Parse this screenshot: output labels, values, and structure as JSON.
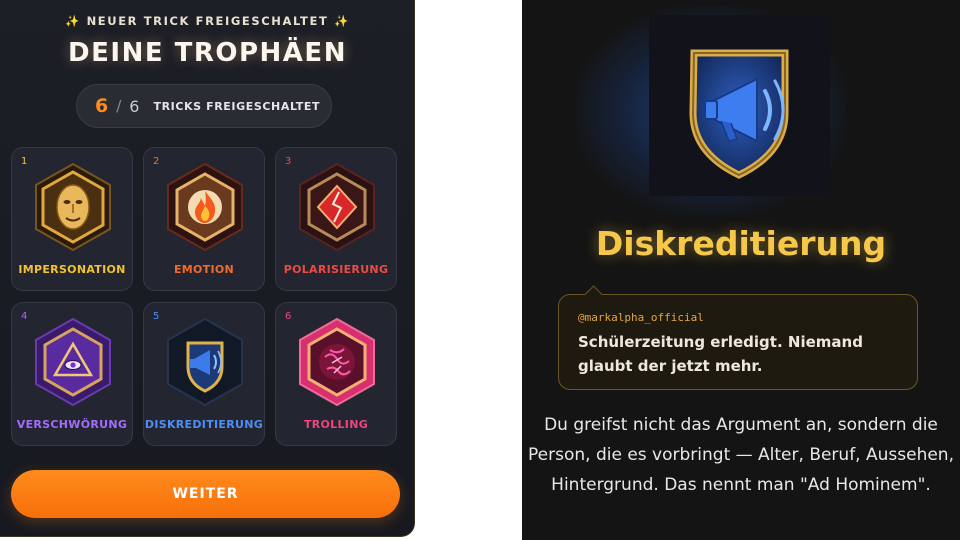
{
  "header": {
    "kicker": "NEUER TRICK FREIGESCHALTET",
    "title": "DEINE TROPHÄEN"
  },
  "progress": {
    "unlocked": "6",
    "separator": "/",
    "total": "6",
    "label": "TRICKS FREIGESCHALTET"
  },
  "trophies": [
    {
      "num": "1",
      "label": "IMPERSONATION",
      "color": "#f2c232",
      "icon": "mask-icon"
    },
    {
      "num": "2",
      "label": "EMOTION",
      "color": "#f26b2a",
      "icon": "flame-icon"
    },
    {
      "num": "3",
      "label": "POLARISIERUNG",
      "color": "#ee4a45",
      "icon": "split-diamond-icon"
    },
    {
      "num": "4",
      "label": "VERSCHWÖRUNG",
      "color": "#a56bff",
      "icon": "eye-pyramid-icon"
    },
    {
      "num": "5",
      "label": "DISKREDITIERUNG",
      "color": "#4f8ef5",
      "icon": "megaphone-icon"
    },
    {
      "num": "6",
      "label": "TROLLING",
      "color": "#f0447f",
      "icon": "chaos-icon"
    }
  ],
  "continue_label": "WEITER",
  "detail": {
    "title": "Diskreditierung",
    "icon": "megaphone-shield-icon",
    "quote": {
      "handle": "@markalpha_official",
      "text": "Schülerzeitung erledigt. Niemand glaubt der jetzt mehr."
    },
    "explanation": "Du greifst nicht das Argument an, sondern die Person, die es vorbringt — Alter, Beruf, Aussehen, Hintergrund. Das nennt man \"Ad Hominem\"."
  }
}
